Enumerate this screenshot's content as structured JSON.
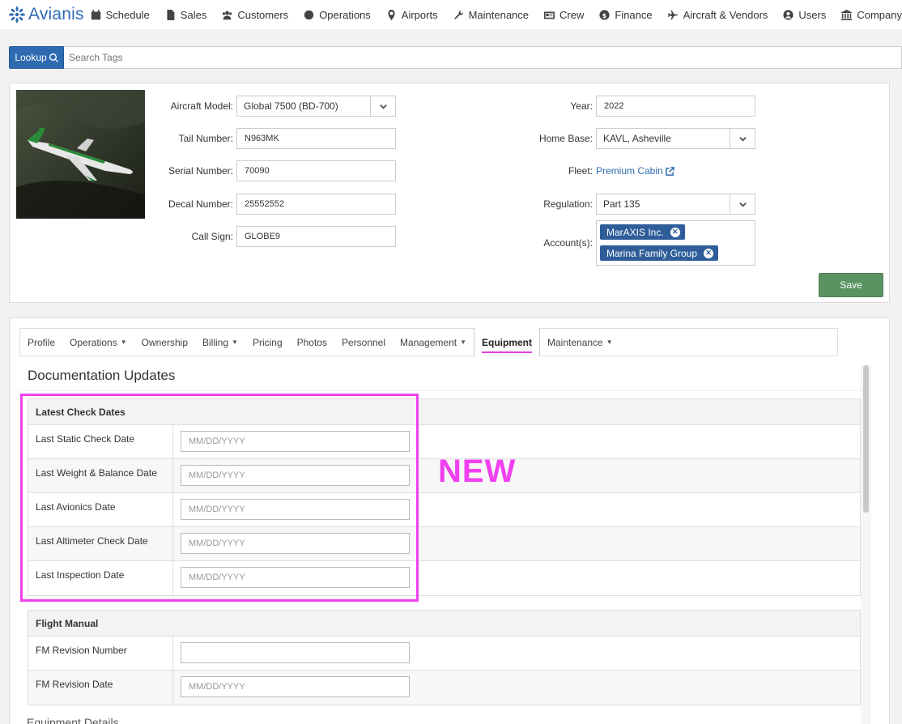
{
  "brand": {
    "name": "Avianis",
    "color": "#2d6ab4"
  },
  "nav": [
    {
      "label": "Schedule",
      "icon": "calendar-icon"
    },
    {
      "label": "Sales",
      "icon": "document-icon"
    },
    {
      "label": "Customers",
      "icon": "users-icon"
    },
    {
      "label": "Operations",
      "icon": "globe-icon"
    },
    {
      "label": "Airports",
      "icon": "map-marker-icon"
    },
    {
      "label": "Maintenance",
      "icon": "wrench-icon"
    },
    {
      "label": "Crew",
      "icon": "id-card-icon"
    },
    {
      "label": "Finance",
      "icon": "dollar-icon"
    },
    {
      "label": "Aircraft & Vendors",
      "icon": "plane-icon"
    },
    {
      "label": "Users",
      "icon": "user-circle-icon"
    },
    {
      "label": "Company",
      "icon": "bank-icon"
    }
  ],
  "lookup": {
    "button_label": "Lookup",
    "placeholder": "Search Tags"
  },
  "aircraft": {
    "model_label": "Aircraft Model:",
    "model_value": "Global 7500 (BD-700)",
    "tail_label": "Tail Number:",
    "tail_value": "N963MK",
    "serial_label": "Serial Number:",
    "serial_value": "70090",
    "decal_label": "Decal Number:",
    "decal_value": "25552552",
    "callsign_label": "Call Sign:",
    "callsign_value": "GLOBE9",
    "year_label": "Year:",
    "year_value": "2022",
    "homebase_label": "Home Base:",
    "homebase_value": "KAVL, Asheville",
    "fleet_label": "Fleet:",
    "fleet_value": "Premium Cabin",
    "regulation_label": "Regulation:",
    "regulation_value": "Part 135",
    "accounts_label": "Account(s):",
    "accounts": [
      "MarAXIS Inc.",
      "Marina Family Group"
    ],
    "save_label": "Save"
  },
  "tabs": [
    {
      "label": "Profile",
      "dropdown": false
    },
    {
      "label": "Operations",
      "dropdown": true
    },
    {
      "label": "Ownership",
      "dropdown": false
    },
    {
      "label": "Billing",
      "dropdown": true
    },
    {
      "label": "Pricing",
      "dropdown": false
    },
    {
      "label": "Photos",
      "dropdown": false
    },
    {
      "label": "Personnel",
      "dropdown": false
    },
    {
      "label": "Management",
      "dropdown": true
    },
    {
      "label": "Equipment",
      "dropdown": false,
      "active": true
    },
    {
      "label": "Maintenance",
      "dropdown": true
    }
  ],
  "section_title": "Documentation Updates",
  "latest_checks": {
    "title": "Latest Check Dates",
    "rows": [
      {
        "label": "Last Static Check Date",
        "value": "",
        "placeholder": "MM/DD/YYYY"
      },
      {
        "label": "Last Weight & Balance Date",
        "value": "",
        "placeholder": "MM/DD/YYYY"
      },
      {
        "label": "Last Avionics Date",
        "value": "",
        "placeholder": "MM/DD/YYYY"
      },
      {
        "label": "Last Altimeter Check Date",
        "value": "",
        "placeholder": "MM/DD/YYYY"
      },
      {
        "label": "Last Inspection Date",
        "value": "",
        "placeholder": "MM/DD/YYYY"
      }
    ]
  },
  "flight_manual": {
    "title": "Flight Manual",
    "rows": [
      {
        "label": "FM Revision Number",
        "value": "",
        "placeholder": ""
      },
      {
        "label": "FM Revision Date",
        "value": "",
        "placeholder": "MM/DD/YYYY"
      }
    ]
  },
  "annotation": {
    "text": "NEW",
    "color": "#f040f0"
  },
  "bottom_heading": "Equipment Details"
}
